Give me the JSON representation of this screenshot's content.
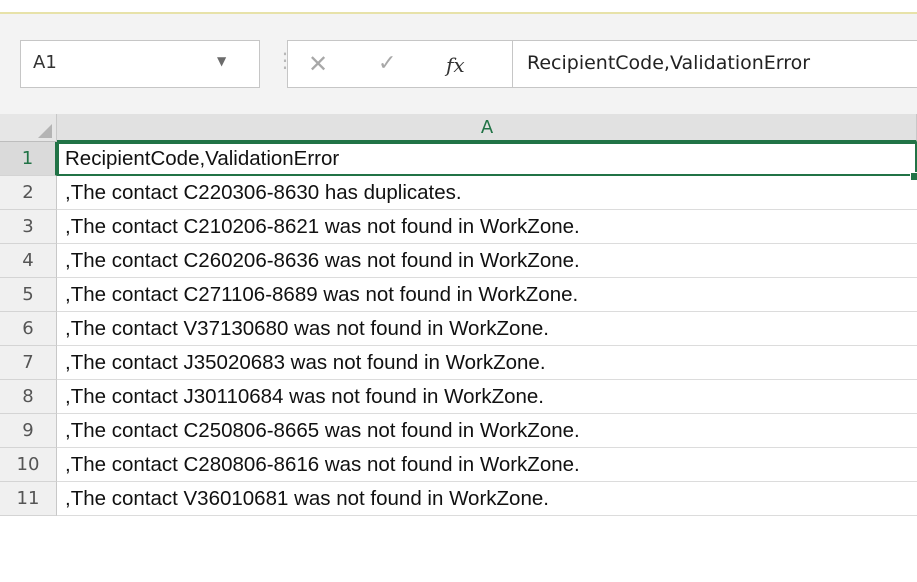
{
  "formula_bar": {
    "name_box": "A1",
    "formula_value": "RecipientCode,ValidationError",
    "fx_label": "fx"
  },
  "icons": {
    "namebox_dropdown": "chevron-down-icon",
    "cancel": "close-icon",
    "enter": "check-icon",
    "insert_function": "fx-icon"
  },
  "grid": {
    "column_header": "A",
    "rows": [
      {
        "number": "1",
        "value": "RecipientCode,ValidationError"
      },
      {
        "number": "2",
        "value": ",The contact C220306-8630 has duplicates."
      },
      {
        "number": "3",
        "value": ",The contact C210206-8621 was not found in WorkZone."
      },
      {
        "number": "4",
        "value": ",The contact C260206-8636 was not found in WorkZone."
      },
      {
        "number": "5",
        "value": ",The contact C271106-8689 was not found in WorkZone."
      },
      {
        "number": "6",
        "value": ",The contact V37130680 was not found in WorkZone."
      },
      {
        "number": "7",
        "value": ",The contact J35020683 was not found in WorkZone."
      },
      {
        "number": "8",
        "value": ",The contact J30110684 was not found in WorkZone."
      },
      {
        "number": "9",
        "value": ",The contact C250806-8665 was not found in WorkZone."
      },
      {
        "number": "10",
        "value": ",The contact C280806-8616 was not found in WorkZone."
      },
      {
        "number": "11",
        "value": ",The contact V36010681 was not found in WorkZone."
      }
    ]
  },
  "colors": {
    "accent": "#217346",
    "header_bg": "#e1e1e1",
    "formula_area_bg": "#f3f3f3"
  }
}
